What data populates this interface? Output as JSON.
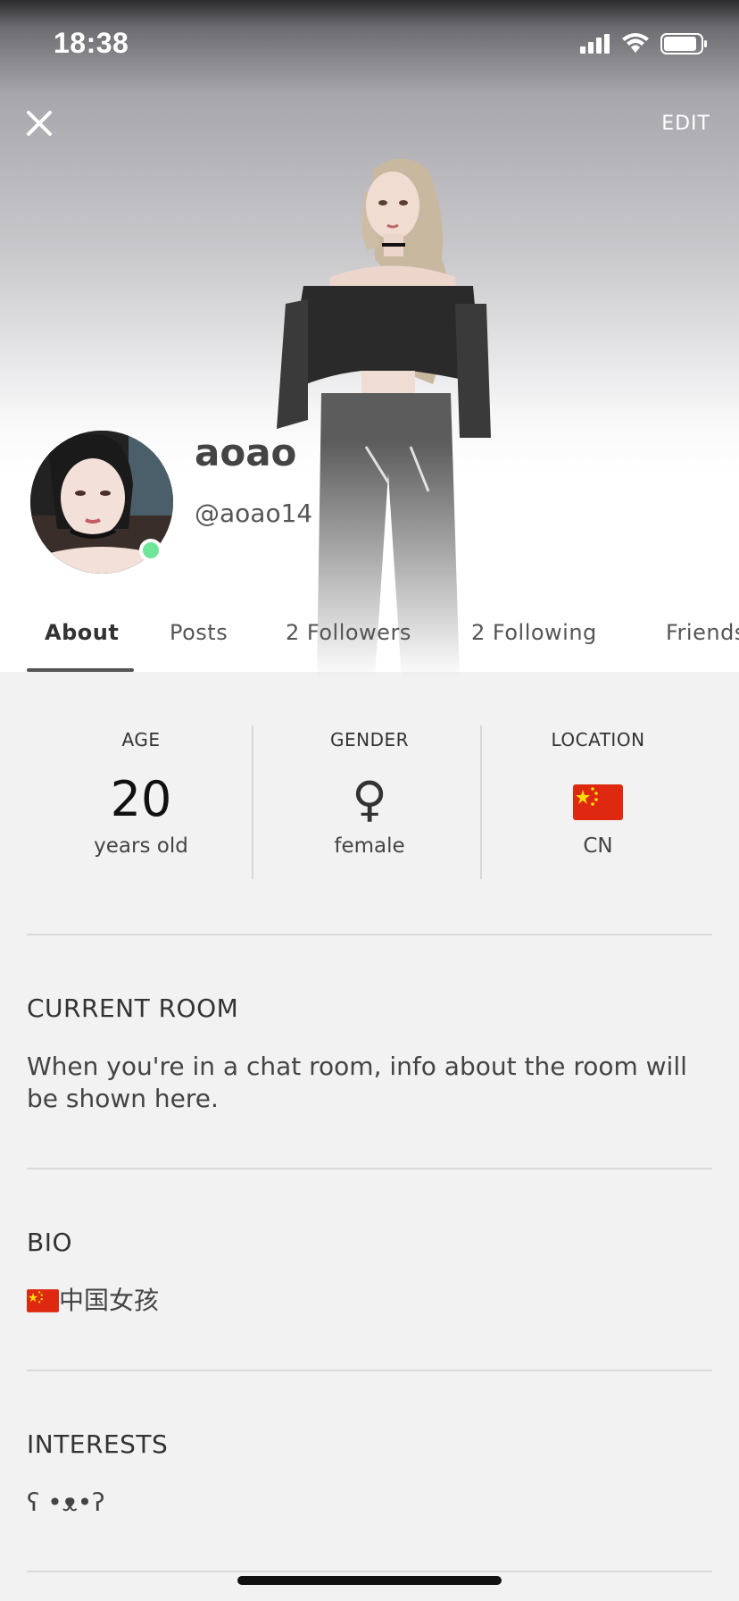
{
  "status_bar": {
    "time": "18:38"
  },
  "header": {
    "edit_label": "EDIT"
  },
  "profile": {
    "display_name": "aoao",
    "username": "@aoao14",
    "online_color": "#6ee598"
  },
  "tabs": [
    {
      "label": "About"
    },
    {
      "label": "Posts"
    },
    {
      "label": "2 Followers"
    },
    {
      "label": "2 Following"
    },
    {
      "label": "Friends"
    }
  ],
  "stats": {
    "age": {
      "label": "AGE",
      "value": "20",
      "sub": "years old"
    },
    "gender": {
      "label": "GENDER",
      "value": "♀",
      "sub": "female"
    },
    "location": {
      "label": "LOCATION",
      "sub": "CN"
    }
  },
  "current_room": {
    "title": "CURRENT ROOM",
    "body": "When you're in a chat room, info about the room will be shown here."
  },
  "bio": {
    "title": "BIO",
    "text": "中国女孩"
  },
  "interests": {
    "title": "INTERESTS",
    "text": "ʕ •ᴥ•ʔ"
  }
}
